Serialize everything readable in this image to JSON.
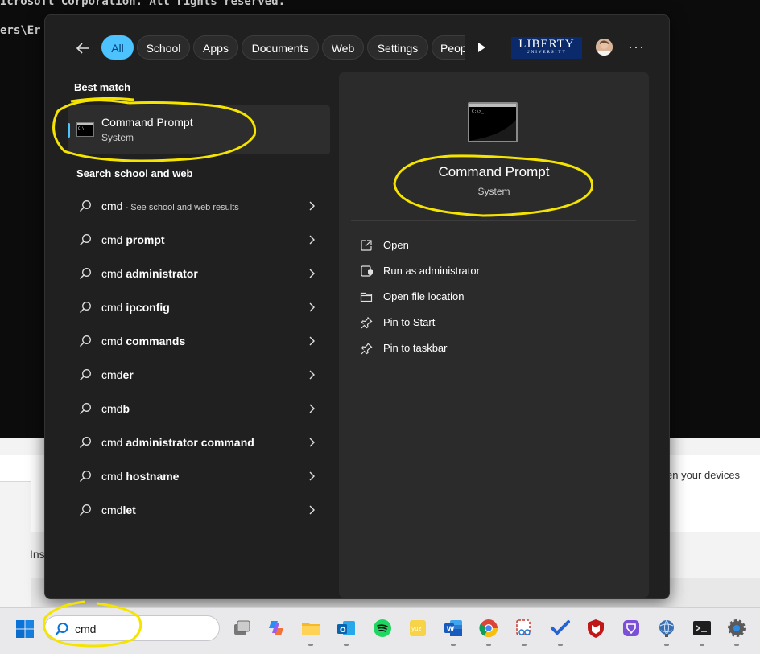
{
  "background": {
    "terminal_line1": "icrosoft Corporation. All rights reserved.",
    "terminal_line2": "ers\\Er",
    "page_text_ins": "Ins",
    "page_text_right": "en your devices"
  },
  "start_menu": {
    "back_label": "←",
    "filters": [
      "All",
      "School",
      "Apps",
      "Documents",
      "Web",
      "Settings",
      "Peop"
    ],
    "org_logo_big": "LIBERTY",
    "org_logo_small": "UNIVERSITY",
    "more_label": "···",
    "best_match_label": "Best match",
    "best_match": {
      "name": "Command Prompt",
      "subtitle": "System"
    },
    "search_school_web_label": "Search school and web",
    "search_items": [
      {
        "prefix": "cmd",
        "bold": "",
        "hint": " - See school and web results"
      },
      {
        "prefix": "cmd ",
        "bold": "prompt",
        "hint": ""
      },
      {
        "prefix": "cmd ",
        "bold": "administrator",
        "hint": ""
      },
      {
        "prefix": "cmd ",
        "bold": "ipconfig",
        "hint": ""
      },
      {
        "prefix": "cmd ",
        "bold": "commands",
        "hint": ""
      },
      {
        "prefix": "cmd",
        "bold": "er",
        "hint": ""
      },
      {
        "prefix": "cmd",
        "bold": "b",
        "hint": ""
      },
      {
        "prefix": "cmd ",
        "bold": "administrator command",
        "hint": ""
      },
      {
        "prefix": "cmd ",
        "bold": "hostname",
        "hint": ""
      },
      {
        "prefix": "cmd",
        "bold": "let",
        "hint": ""
      }
    ],
    "detail": {
      "title": "Command Prompt",
      "subtitle": "System",
      "actions": [
        {
          "label": "Open",
          "icon": "open-external-icon"
        },
        {
          "label": "Run as administrator",
          "icon": "shield-admin-icon"
        },
        {
          "label": "Open file location",
          "icon": "folder-icon"
        },
        {
          "label": "Pin to Start",
          "icon": "pin-icon"
        },
        {
          "label": "Pin to taskbar",
          "icon": "pin-icon"
        }
      ]
    }
  },
  "taskbar": {
    "search_value": "cmd",
    "apps": [
      "task-view",
      "copilot",
      "file-explorer",
      "outlook",
      "spotify",
      "notes-app",
      "word",
      "chrome",
      "snipping-tool",
      "todo",
      "mcafee",
      "proton-vpn",
      "network-globe",
      "terminal",
      "settings"
    ]
  },
  "colors": {
    "accent": "#4cc2ff",
    "menu_bg": "#202020",
    "pane_bg": "#2b2b2b",
    "highlight": "#f5e400"
  }
}
